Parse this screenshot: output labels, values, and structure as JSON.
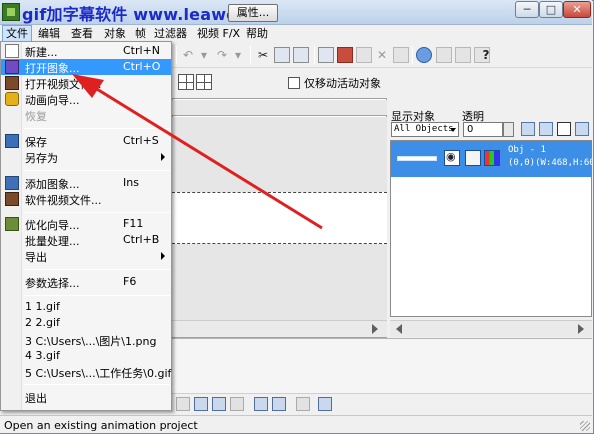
{
  "window": {
    "title": "gif加字幕软件 www.leawo.cn",
    "controls": {
      "minimize": "─",
      "maximize": "□",
      "close": "✕"
    }
  },
  "menubar": [
    "文件",
    "编辑",
    "查看",
    "对象",
    "帧",
    "过滤器",
    "视频 F/X",
    "帮助"
  ],
  "toolbar2": {
    "properties_button": "属性...",
    "move_active_label": "仅移动活动对象",
    "move_active_checked": false
  },
  "file_menu": {
    "items": [
      {
        "label": "新建...",
        "shortcut": "Ctrl+N",
        "icon": "new-file-icon"
      },
      {
        "label": "打开图象...",
        "shortcut": "Ctrl+O",
        "icon": "open-image-icon",
        "highlighted": true
      },
      {
        "label": "打开视频文件...",
        "shortcut": "",
        "icon": "open-video-icon"
      },
      {
        "label": "动画向导...",
        "shortcut": "",
        "icon": "animation-wizard-icon"
      },
      {
        "label": "恢复",
        "shortcut": "",
        "disabled": true
      },
      {
        "label": "保存",
        "shortcut": "Ctrl+S",
        "icon": "save-icon"
      },
      {
        "label": "另存为",
        "shortcut": "",
        "submenu": true
      },
      {
        "label": "添加图象...",
        "shortcut": "Ins",
        "icon": "add-image-icon"
      },
      {
        "label": "软件视频文件...",
        "shortcut": "",
        "icon": "video-file-icon"
      },
      {
        "label": "优化向导...",
        "shortcut": "F11",
        "icon": "optimize-wizard-icon"
      },
      {
        "label": "批量处理...",
        "shortcut": "Ctrl+B"
      },
      {
        "label": "导出",
        "shortcut": "",
        "submenu": true
      },
      {
        "label": "参数选择...",
        "shortcut": "F6"
      },
      {
        "label": "1 1.gif"
      },
      {
        "label": "2 2.gif"
      },
      {
        "label": "3 C:\\Users\\...\\图片\\1.png"
      },
      {
        "label": "4 3.gif"
      },
      {
        "label": "5 C:\\Users\\...\\工作任务\\0.gif"
      },
      {
        "label": "退出"
      }
    ]
  },
  "right_panel": {
    "show_objects_label": "显示对象",
    "opacity_label": "透明",
    "objects_select_value": "All Objects",
    "opacity_value": "0",
    "object": {
      "name": "Obj - 1",
      "geometry": "(0,0)(W:468,H:60)"
    }
  },
  "status_bar": {
    "text": "Open an existing animation project"
  },
  "colors": {
    "highlight": "#3399ff",
    "arrow": "#e02020",
    "title": "#1c2ac9",
    "object_row": "#3d8ee6"
  }
}
